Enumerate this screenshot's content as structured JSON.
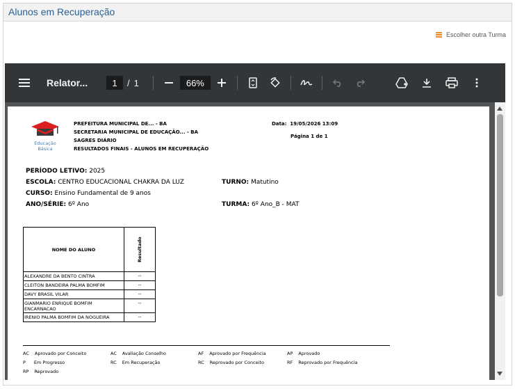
{
  "page": {
    "title": "Alunos em Recuperação",
    "choose_class_label": "Escolher outra Turma"
  },
  "viewer": {
    "doc_title": "Relator...",
    "current_page": "1",
    "page_separator": "/",
    "total_pages": "1",
    "zoom": "66%",
    "icons": [
      "menu-icon",
      "zoom-out-icon",
      "zoom-in-icon",
      "fit-page-icon",
      "rotate-icon",
      "annotate-icon",
      "undo-icon",
      "redo-icon",
      "drive-add-icon",
      "download-icon",
      "print-icon",
      "more-icon"
    ]
  },
  "report": {
    "logo_text_1": "Educação",
    "logo_text_2": "Básica",
    "header_lines": [
      "PREFEITURA MUNICIPAL DE... - BA",
      "SECRETARIA MUNICIPAL DE EDUCAÇÃO... - BA",
      "SAGRES DIÁRIO",
      "RESULTADOS FINAIS - ALUNOS EM RECUPERAÇÃO"
    ],
    "date_label": "Data:",
    "date_value": "19/05/2026 13:09",
    "page_info": "Página 1 de 1",
    "period_label": "PERÍODO LETIVO:",
    "period_value": "2025",
    "school_label": "ESCOLA:",
    "school_value": "CENTRO EDUCACIONAL CHAKRA DA LUZ",
    "shift_label": "TURNO:",
    "shift_value": "Matutino",
    "course_label": "CURSO:",
    "course_value": "Ensino Fundamental de 9 anos",
    "grade_label": "ANO/SÉRIE:",
    "grade_value": "6º Ano",
    "class_label": "TURMA:",
    "class_value": "6º Ano_B - MAT",
    "table_headers": {
      "name": "NOME DO ALUNO",
      "result": "Resultado"
    },
    "students": [
      {
        "name": "ALEXANDRE DA BENTO CINTRA",
        "result": "--"
      },
      {
        "name": "CLEITON BANDEIRA PALMA BOMFIM",
        "result": "--"
      },
      {
        "name": "DAVY BRASIL VILAR",
        "result": "--"
      },
      {
        "name": "GIANMARIO ENRIQUE BOMFIM ENCARNACAO",
        "result": "--"
      },
      {
        "name": "IRENIO PALMA BOMFIM DA NOGUEIRA",
        "result": "--"
      }
    ],
    "legend": [
      {
        "code": "AC",
        "desc": "Aprovado por Conceito"
      },
      {
        "code": "AC",
        "desc": "Avaliação Conselho"
      },
      {
        "code": "AF",
        "desc": "Aprovado por Frequência"
      },
      {
        "code": "AP",
        "desc": "Aprovado"
      },
      {
        "code": "P",
        "desc": "Em Progresso"
      },
      {
        "code": "RC",
        "desc": "Em Recuperação"
      },
      {
        "code": "RC",
        "desc": "Reprovado por Conceito"
      },
      {
        "code": "RF",
        "desc": "Reprovado por Frequência"
      },
      {
        "code": "RP",
        "desc": "Reprovado"
      }
    ]
  }
}
